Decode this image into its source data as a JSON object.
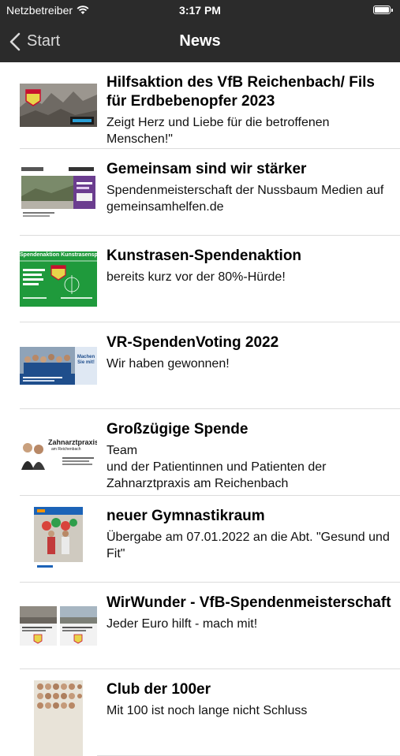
{
  "status": {
    "carrier": "Netzbetreiber",
    "time": "3:17 PM"
  },
  "nav": {
    "back_label": "Start",
    "title": "News"
  },
  "news": [
    {
      "title": "Hilfsaktion des VfB Reichenbach/ Fils für Erdbebenopfer 2023",
      "subtitle": "Zeigt Herz und Liebe für die betroffenen Menschen!\""
    },
    {
      "title": "Gemeinsam sind wir stärker",
      "subtitle": "Spendenmeisterschaft der Nussbaum Medien auf gemeinsamhelfen.de"
    },
    {
      "title": "Kunstrasen-Spendenaktion",
      "subtitle": "bereits kurz vor der 80%-Hürde!"
    },
    {
      "title": "VR-SpendenVoting 2022",
      "subtitle": "Wir haben gewonnen!"
    },
    {
      "title": "Großzügige Spende",
      "subtitle": "Team\nund der Patientinnen und Patienten der Zahnarztpraxis am Reichenbach"
    },
    {
      "title": "neuer Gymnastikraum",
      "subtitle": "Übergabe am 07.01.2022 an die Abt. \"Gesund und Fit\""
    },
    {
      "title": "WirWunder - VfB-Spendenmeisterschaft",
      "subtitle": "Jeder Euro hilft - mach mit!"
    },
    {
      "title": "Club der 100er",
      "subtitle": "Mit 100 ist noch lange nicht Schluss"
    }
  ],
  "thumbs": {
    "spendenaktion": "Spendenaktion Kunstrasenspielfeld",
    "machen_sie_mit": "Machen Sie mit!",
    "zahnarzt": "Zahnarztpraxis",
    "zahnarzt_sub": "am Reichenbach"
  }
}
